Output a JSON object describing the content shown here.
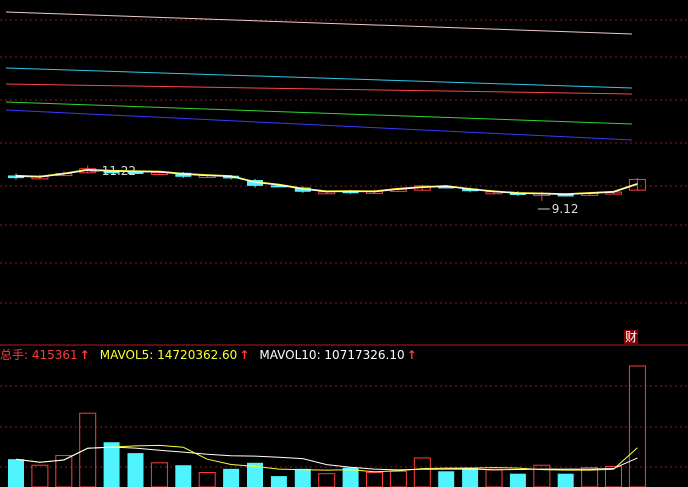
{
  "colors": {
    "up": "#ff3c3c",
    "down": "#4ff4ff",
    "ma_white": "#ffffff",
    "ma_yellow": "#ffff33",
    "grid": "#8a1a1a",
    "ma_lines": [
      "#f0c8c8",
      "#33c8e8",
      "#ff4444",
      "#33d433",
      "#3a3aff"
    ]
  },
  "price_panel": {
    "high_label": "11.22",
    "low_label": "9.12"
  },
  "volume_header": {
    "total_label": "总手: 415361",
    "total_arrow": "↑",
    "mavol5_label": "MAVOL5: 14720362.60",
    "mavol5_arrow": "↑",
    "mavol10_label": "MAVOL10: 10717326.10",
    "mavol10_arrow": "↑"
  },
  "finance_badge": "财",
  "chart_data": {
    "type": "candlestick",
    "candles": [
      {
        "o": 10.85,
        "c": 10.75,
        "h": 10.92,
        "l": 10.7
      },
      {
        "o": 10.72,
        "c": 10.82,
        "h": 10.88,
        "l": 10.7
      },
      {
        "o": 10.85,
        "c": 10.92,
        "h": 11.0,
        "l": 10.82
      },
      {
        "o": 10.95,
        "c": 11.1,
        "h": 11.22,
        "l": 10.92
      },
      {
        "o": 11.0,
        "c": 10.98,
        "h": 11.05,
        "l": 10.94
      },
      {
        "o": 10.98,
        "c": 10.96,
        "h": 11.03,
        "l": 10.94
      },
      {
        "o": 10.96,
        "c": 10.96,
        "h": 11.0,
        "l": 10.92
      },
      {
        "o": 10.95,
        "c": 10.8,
        "h": 10.98,
        "l": 10.76
      },
      {
        "o": 10.8,
        "c": 10.85,
        "h": 10.88,
        "l": 10.78
      },
      {
        "o": 10.84,
        "c": 10.74,
        "h": 10.86,
        "l": 10.7
      },
      {
        "o": 10.68,
        "c": 10.46,
        "h": 10.72,
        "l": 10.4
      },
      {
        "o": 10.48,
        "c": 10.46,
        "h": 10.52,
        "l": 10.42
      },
      {
        "o": 10.4,
        "c": 10.24,
        "h": 10.44,
        "l": 10.2
      },
      {
        "o": 10.2,
        "c": 10.24,
        "h": 10.28,
        "l": 10.16
      },
      {
        "o": 10.26,
        "c": 10.2,
        "h": 10.3,
        "l": 10.16
      },
      {
        "o": 10.18,
        "c": 10.26,
        "h": 10.32,
        "l": 10.16
      },
      {
        "o": 10.3,
        "c": 10.33,
        "h": 10.36,
        "l": 10.28
      },
      {
        "o": 10.3,
        "c": 10.46,
        "h": 10.5,
        "l": 10.28
      },
      {
        "o": 10.44,
        "c": 10.4,
        "h": 10.48,
        "l": 10.38
      },
      {
        "o": 10.36,
        "c": 10.26,
        "h": 10.4,
        "l": 10.22
      },
      {
        "o": 10.2,
        "c": 10.24,
        "h": 10.3,
        "l": 10.14
      },
      {
        "o": 10.2,
        "c": 10.12,
        "h": 10.26,
        "l": 10.08
      },
      {
        "o": 10.1,
        "c": 10.18,
        "h": 10.24,
        "l": 9.12
      },
      {
        "o": 10.14,
        "c": 10.1,
        "h": 10.18,
        "l": 10.06
      },
      {
        "o": 10.14,
        "c": 10.18,
        "h": 10.22,
        "l": 10.1
      },
      {
        "o": 10.18,
        "c": 10.23,
        "h": 10.26,
        "l": 10.15
      },
      {
        "o": 10.3,
        "c": 10.7,
        "h": 10.76,
        "l": 10.28
      }
    ],
    "volume": [
      0.23,
      0.18,
      0.26,
      0.61,
      0.37,
      0.28,
      0.2,
      0.18,
      0.12,
      0.15,
      0.2,
      0.09,
      0.15,
      0.11,
      0.16,
      0.12,
      0.13,
      0.24,
      0.13,
      0.16,
      0.14,
      0.11,
      0.18,
      0.11,
      0.16,
      0.17,
      1.0
    ],
    "price_ylim": [
      9.0,
      12.0
    ],
    "volume_ylim": [
      0,
      1.0
    ]
  }
}
